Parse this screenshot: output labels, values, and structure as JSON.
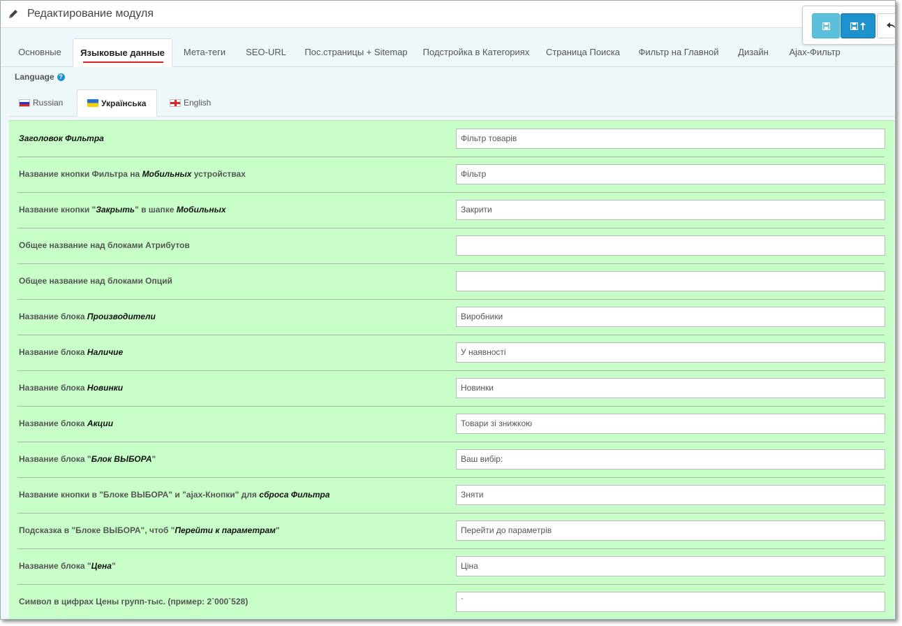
{
  "header": {
    "title": "Редактирование модуля"
  },
  "tabs": [
    "Основные",
    "Языковые данные",
    "Мета-теги",
    "SEO-URL",
    "Пос.страницы + Sitemap",
    "Подстройка в Категориях",
    "Страница Поиска",
    "Фильтр на Главной",
    "Дизайн",
    "Ajax-Фильтр"
  ],
  "language": {
    "label": "Language",
    "tabs": [
      "Russian",
      "Українська",
      "English"
    ]
  },
  "fields": [
    {
      "label_parts": [
        {
          "t": "Заголовок Фильтра",
          "em": true
        }
      ],
      "value": "Фільтр товарів"
    },
    {
      "label_parts": [
        {
          "t": "Название кнопки Фильтра на "
        },
        {
          "t": "Мобильных",
          "em": true
        },
        {
          "t": " устройствах"
        }
      ],
      "value": "Фільтр"
    },
    {
      "label_parts": [
        {
          "t": "Название кнопки \""
        },
        {
          "t": "Закрыть",
          "em": true
        },
        {
          "t": "\" в шапке "
        },
        {
          "t": "Мобильных",
          "em": true
        }
      ],
      "value": "Закрити"
    },
    {
      "label_parts": [
        {
          "t": "Общее название над блоками Атрибутов"
        }
      ],
      "value": ""
    },
    {
      "label_parts": [
        {
          "t": "Общее название над блоками Опций"
        }
      ],
      "value": ""
    },
    {
      "label_parts": [
        {
          "t": "Название блока "
        },
        {
          "t": "Производители",
          "em": true
        }
      ],
      "value": "Виробники"
    },
    {
      "label_parts": [
        {
          "t": "Название блока "
        },
        {
          "t": "Наличие",
          "em": true
        }
      ],
      "value": "У наявності"
    },
    {
      "label_parts": [
        {
          "t": "Название блока "
        },
        {
          "t": "Новинки",
          "em": true
        }
      ],
      "value": "Новинки"
    },
    {
      "label_parts": [
        {
          "t": "Название блока "
        },
        {
          "t": "Акции",
          "em": true
        }
      ],
      "value": "Товари зі знижкою"
    },
    {
      "label_parts": [
        {
          "t": "Название блока \""
        },
        {
          "t": "Блок ВЫБОРА",
          "em": true
        },
        {
          "t": "\""
        }
      ],
      "value": "Ваш вибір:"
    },
    {
      "label_parts": [
        {
          "t": "Название кнопки в \"Блоке ВЫБОРА\" и \"ajax-Кнопки\" для "
        },
        {
          "t": "сброса Фильтра",
          "em": true
        }
      ],
      "value": "Зняти"
    },
    {
      "label_parts": [
        {
          "t": "Подсказка в \"Блоке ВЫБОРА\", чтоб \""
        },
        {
          "t": "Перейти к параметрам",
          "em": true
        },
        {
          "t": "\""
        }
      ],
      "value": "Перейти до параметрів"
    },
    {
      "label_parts": [
        {
          "t": "Название блока \""
        },
        {
          "t": "Цена",
          "em": true
        },
        {
          "t": "\""
        }
      ],
      "value": "Ціна"
    },
    {
      "label_parts": [
        {
          "t": "Символ в цифрах Цены групп-тыс. (пример: 2`000`528)"
        }
      ],
      "value": "`"
    }
  ]
}
